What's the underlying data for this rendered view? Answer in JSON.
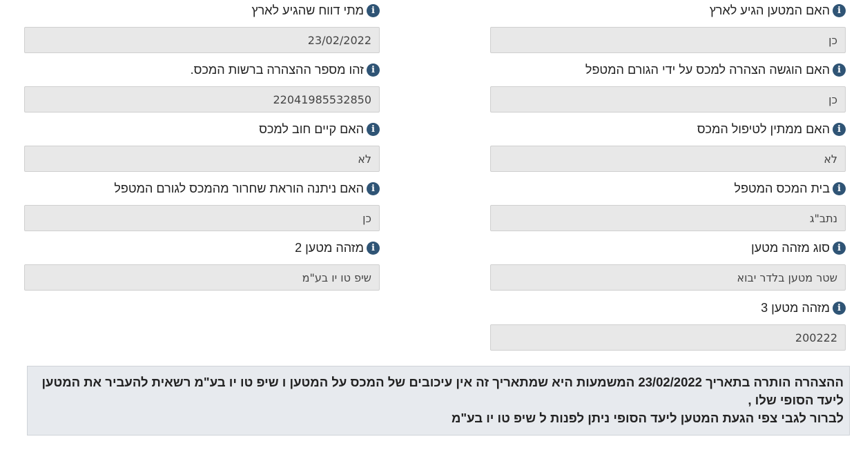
{
  "fields": {
    "arrived": {
      "label": "האם המטען הגיע לארץ",
      "value": "כן"
    },
    "report_date": {
      "label": "מתי דווח שהגיע לארץ",
      "value": "23/02/2022"
    },
    "declaration_submitted": {
      "label": "האם הוגשה הצהרה למכס על ידי הגורם המטפל",
      "value": "כן"
    },
    "declaration_number": {
      "label": "זהו מספר ההצהרה ברשות המכס.",
      "value": "22041985532850"
    },
    "awaiting_customs": {
      "label": "האם ממתין לטיפול המכס",
      "value": "לא"
    },
    "customs_debt": {
      "label": "האם קיים חוב למכס",
      "value": "לא"
    },
    "customs_house": {
      "label": "בית המכס המטפל",
      "value": "נתב\"ג"
    },
    "release_order": {
      "label": "האם ניתנה הוראת שחרור מהמכס לגורם המטפל",
      "value": "כן"
    },
    "cargo_id_type": {
      "label": "סוג מזהה מטען",
      "value": "שטר מטען בלדר יבוא"
    },
    "cargo_id_2": {
      "label": "מזהה מטען 2",
      "value": "שיפ טו יו בע\"מ"
    },
    "cargo_id_3": {
      "label": "מזהה מטען 3",
      "value": "200222"
    }
  },
  "notice": {
    "line1": "ההצהרה הותרה בתאריך 23/02/2022 המשמעות היא שמתאריך זה אין עיכובים של המכס על המטען ו שיפ טו יו בע\"מ רשאית להעביר את המטען",
    "line2": "ליעד הסופי שלו ,",
    "line3": "לברור לגבי צפי הגעת המטען ליעד הסופי ניתן לפנות ל שיפ טו יו בע\"מ"
  },
  "icons": {
    "info": "info-icon",
    "info_glyph": "i"
  },
  "colors": {
    "icon": "#2f5475",
    "field_bg": "#e8e8e8",
    "notice_bg": "#e7eaee"
  }
}
